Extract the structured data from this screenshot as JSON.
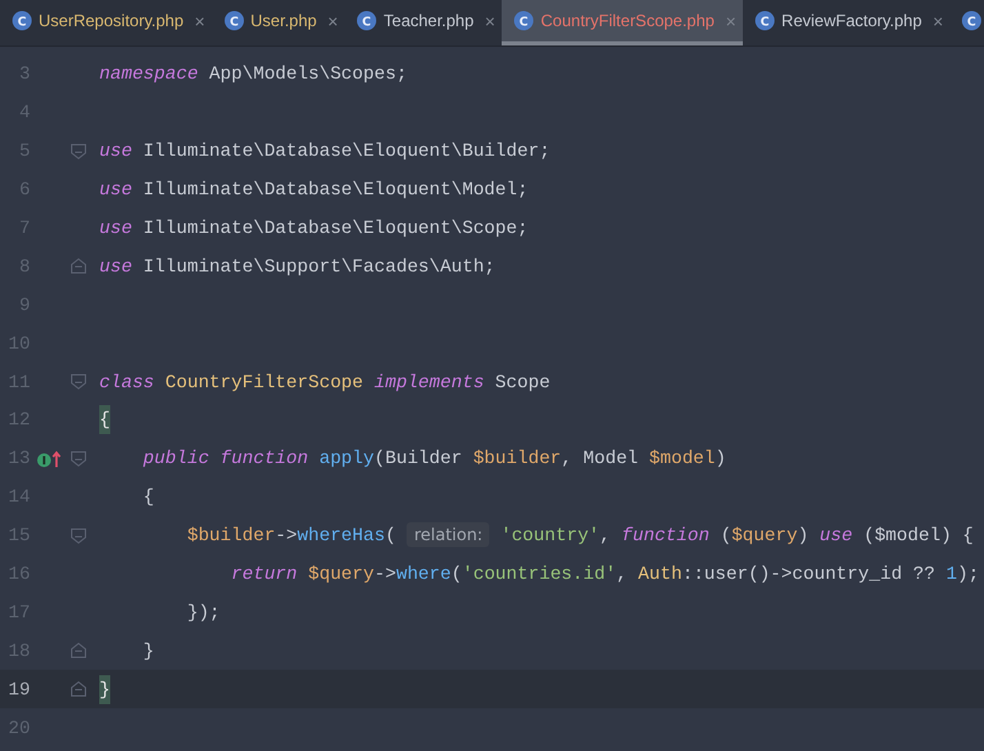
{
  "tabs": [
    {
      "icon": "C",
      "label": "UserRepository.php",
      "color": "#d9b870",
      "selected": false,
      "close": "×"
    },
    {
      "icon": "C",
      "label": "User.php",
      "color": "#d9b870",
      "selected": false,
      "close": "×"
    },
    {
      "icon": "C",
      "label": "Teacher.php",
      "color": "#c5c9d1",
      "selected": false,
      "close": "×"
    },
    {
      "icon": "C",
      "label": "CountryFilterScope.php",
      "color": "#e5736a",
      "selected": true,
      "close": "×"
    },
    {
      "icon": "C",
      "label": "ReviewFactory.php",
      "color": "#c5c9d1",
      "selected": false,
      "close": "×"
    },
    {
      "icon": "C",
      "selected": false
    }
  ],
  "lines": [
    {
      "number": "3",
      "fold_open": false,
      "fold_close": false,
      "implements": false,
      "current": false,
      "tokens": [
        {
          "kind": "kw",
          "text": "namespace"
        },
        {
          "kind": "plain",
          "text": " App\\Models\\Scopes;"
        }
      ]
    },
    {
      "number": "4",
      "fold_open": false,
      "fold_close": false,
      "implements": false,
      "current": false
    },
    {
      "number": "5",
      "fold_open": true,
      "fold_close": false,
      "implements": false,
      "current": false,
      "tokens": [
        {
          "kind": "kw",
          "text": "use"
        },
        {
          "kind": "plain",
          "text": " Illuminate\\Database\\Eloquent\\Builder;"
        }
      ]
    },
    {
      "number": "6",
      "fold_open": false,
      "fold_close": false,
      "implements": false,
      "current": false,
      "tokens": [
        {
          "kind": "kw",
          "text": "use"
        },
        {
          "kind": "plain",
          "text": " Illuminate\\Database\\Eloquent\\Model;"
        }
      ]
    },
    {
      "number": "7",
      "fold_open": false,
      "fold_close": false,
      "implements": false,
      "current": false,
      "tokens": [
        {
          "kind": "kw",
          "text": "use"
        },
        {
          "kind": "plain",
          "text": " Illuminate\\Database\\Eloquent\\Scope;"
        }
      ]
    },
    {
      "number": "8",
      "fold_open": false,
      "fold_close": true,
      "implements": false,
      "current": false,
      "tokens": [
        {
          "kind": "kw",
          "text": "use"
        },
        {
          "kind": "plain",
          "text": " Illuminate\\Support\\Facades\\Auth;"
        }
      ]
    },
    {
      "number": "9",
      "fold_open": false,
      "fold_close": false,
      "implements": false,
      "current": false
    },
    {
      "number": "10",
      "fold_open": false,
      "fold_close": false,
      "implements": false,
      "current": false
    },
    {
      "number": "11",
      "fold_open": true,
      "fold_close": false,
      "implements": false,
      "current": false,
      "tokens": [
        {
          "kind": "kw",
          "text": "class"
        },
        {
          "kind": "type",
          "text": " CountryFilterScope "
        },
        {
          "kind": "kw",
          "text": "implements"
        },
        {
          "kind": "plain",
          "text": " Scope"
        }
      ]
    },
    {
      "number": "12",
      "fold_open": false,
      "fold_close": false,
      "implements": false,
      "current": false,
      "tokens": [
        {
          "kind": "brace",
          "text": "{"
        }
      ]
    },
    {
      "number": "13",
      "fold_open": true,
      "fold_close": false,
      "implements": true,
      "current": false,
      "tokens": [
        {
          "kind": "kw",
          "text": "    public function "
        },
        {
          "kind": "fn",
          "text": "apply"
        },
        {
          "kind": "plain",
          "text": "(Builder "
        },
        {
          "kind": "var",
          "text": "$builder"
        },
        {
          "kind": "plain",
          "text": ", Model "
        },
        {
          "kind": "var",
          "text": "$model"
        },
        {
          "kind": "plain",
          "text": ")"
        }
      ]
    },
    {
      "number": "14",
      "fold_open": false,
      "fold_close": false,
      "implements": false,
      "current": false,
      "tokens": [
        {
          "kind": "plain",
          "text": "    {"
        }
      ]
    },
    {
      "number": "15",
      "fold_open": true,
      "fold_close": false,
      "implements": false,
      "current": false,
      "tokens": [
        {
          "kind": "var",
          "text": "        $builder"
        },
        {
          "kind": "plain",
          "text": "->"
        },
        {
          "kind": "fn",
          "text": "whereHas"
        },
        {
          "kind": "plain",
          "text": "( "
        },
        {
          "kind": "hint",
          "text": "relation:"
        },
        {
          "kind": "str",
          "text": " 'country'"
        },
        {
          "kind": "plain",
          "text": ", "
        },
        {
          "kind": "kw",
          "text": "function "
        },
        {
          "kind": "plain",
          "text": "("
        },
        {
          "kind": "var",
          "text": "$query"
        },
        {
          "kind": "plain",
          "text": ") "
        },
        {
          "kind": "kw",
          "text": "use "
        },
        {
          "kind": "plain",
          "text": "($model) {"
        }
      ]
    },
    {
      "number": "16",
      "fold_open": false,
      "fold_close": false,
      "implements": false,
      "current": false,
      "tokens": [
        {
          "kind": "kw",
          "text": "            return "
        },
        {
          "kind": "var",
          "text": "$query"
        },
        {
          "kind": "plain",
          "text": "->"
        },
        {
          "kind": "fn",
          "text": "where"
        },
        {
          "kind": "plain",
          "text": "("
        },
        {
          "kind": "str",
          "text": "'countries.id'"
        },
        {
          "kind": "plain",
          "text": ", "
        },
        {
          "kind": "type",
          "text": "Auth"
        },
        {
          "kind": "plain",
          "text": "::user()->country_id ?? "
        },
        {
          "kind": "fn",
          "text": "1"
        },
        {
          "kind": "plain",
          "text": ");"
        }
      ]
    },
    {
      "number": "17",
      "fold_open": false,
      "fold_close": false,
      "implements": false,
      "current": false,
      "tokens": [
        {
          "kind": "plain",
          "text": "        });"
        }
      ]
    },
    {
      "number": "18",
      "fold_open": false,
      "fold_close": true,
      "implements": false,
      "current": false,
      "tokens": [
        {
          "kind": "plain",
          "text": "    }"
        }
      ]
    },
    {
      "number": "19",
      "fold_open": false,
      "fold_close": true,
      "implements": false,
      "current": true,
      "tokens": [
        {
          "kind": "brace",
          "text": "}"
        }
      ]
    },
    {
      "number": "20",
      "fold_open": false,
      "fold_close": false,
      "implements": false,
      "current": false
    }
  ]
}
